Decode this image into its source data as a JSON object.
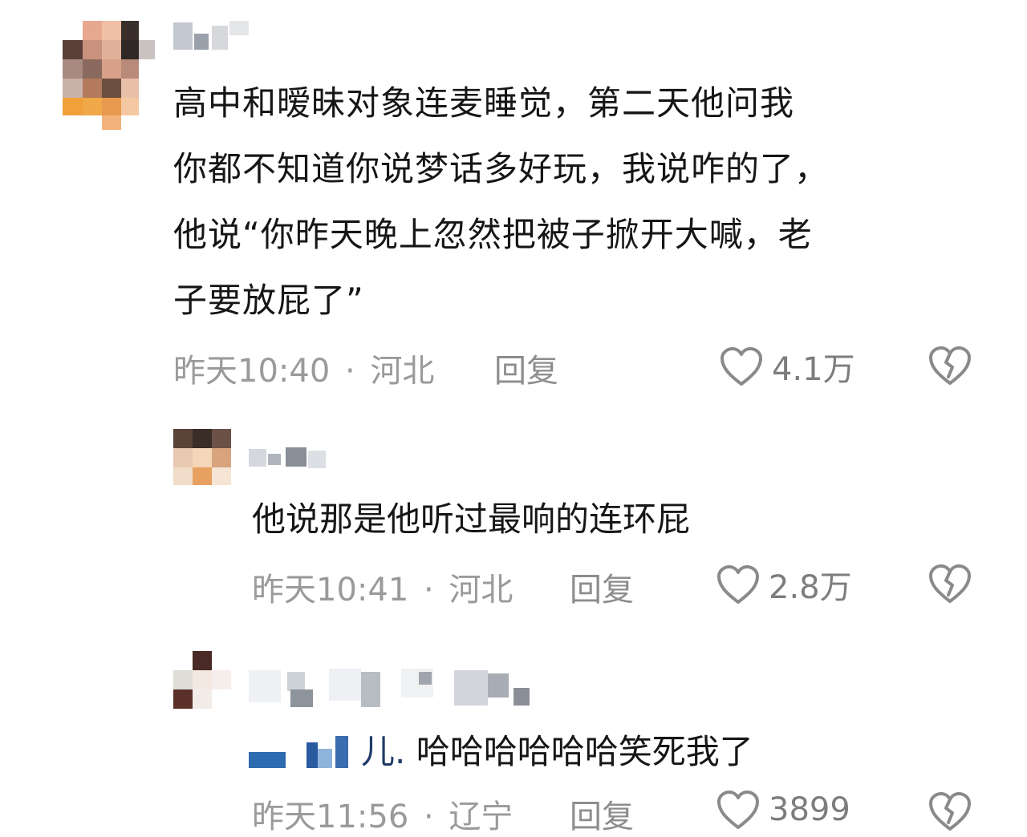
{
  "comments": [
    {
      "text_lines": [
        "高中和暧昧对象连麦睡觉，第二天他问我",
        "你都不知道你说梦话多好玩，我说咋的了，",
        "他说“你昨天晚上忽然把被子掀开大喊，老",
        "子要放屁了”"
      ],
      "time": "昨天10:40",
      "location": "河北",
      "reply_label": "回复",
      "likes": "4.1万"
    },
    {
      "text": "他说那是他听过最响的连环屁",
      "time": "昨天10:41",
      "location": "河北",
      "reply_label": "回复",
      "likes": "2.8万"
    },
    {
      "mention_suffix": "儿.",
      "text": "哈哈哈哈哈哈笑死我了",
      "time": "昨天11:56",
      "location": "辽宁",
      "reply_label": "回复",
      "likes": "3899"
    }
  ],
  "separator": "·",
  "icons": {
    "like": "heart-outline-icon",
    "dislike": "broken-heart-icon"
  },
  "colors": {
    "text": "#161616",
    "meta": "#9a9a9a",
    "mention": "#1f3b66"
  }
}
